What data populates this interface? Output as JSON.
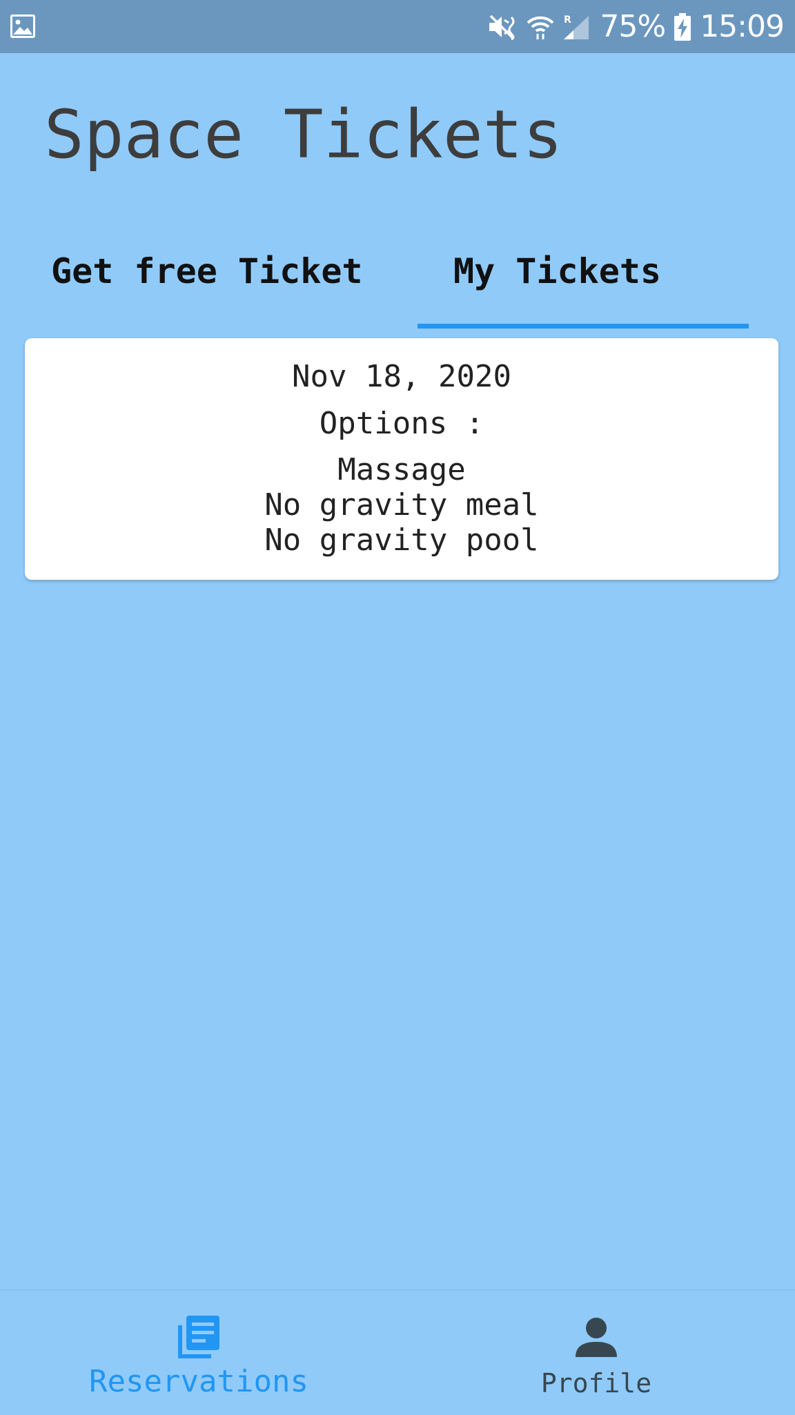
{
  "status_bar": {
    "battery": "75%",
    "time": "15:09",
    "icons": [
      "gallery-notification-icon",
      "mute-icon",
      "wifi-icon",
      "signal-roaming-icon",
      "battery-charging-icon"
    ]
  },
  "app": {
    "title": "Space Tickets"
  },
  "tabs": [
    {
      "label": "Get free Ticket",
      "selected": false
    },
    {
      "label": "My Tickets",
      "selected": true
    }
  ],
  "ticket": {
    "date": "Nov 18, 2020",
    "options_label": "Options :",
    "options": [
      "Massage",
      "No gravity meal",
      "No gravity pool"
    ]
  },
  "bottom_nav": {
    "items": [
      {
        "label": "Reservations",
        "icon": "reservations-icon",
        "active": true
      },
      {
        "label": "Profile",
        "icon": "person-icon",
        "active": false
      }
    ]
  },
  "colors": {
    "background": "#90CAF9",
    "status_bar": "#6B97BF",
    "accent": "#2196F3",
    "title_text": "#3d3d3d",
    "inactive_nav": "#37474F"
  }
}
